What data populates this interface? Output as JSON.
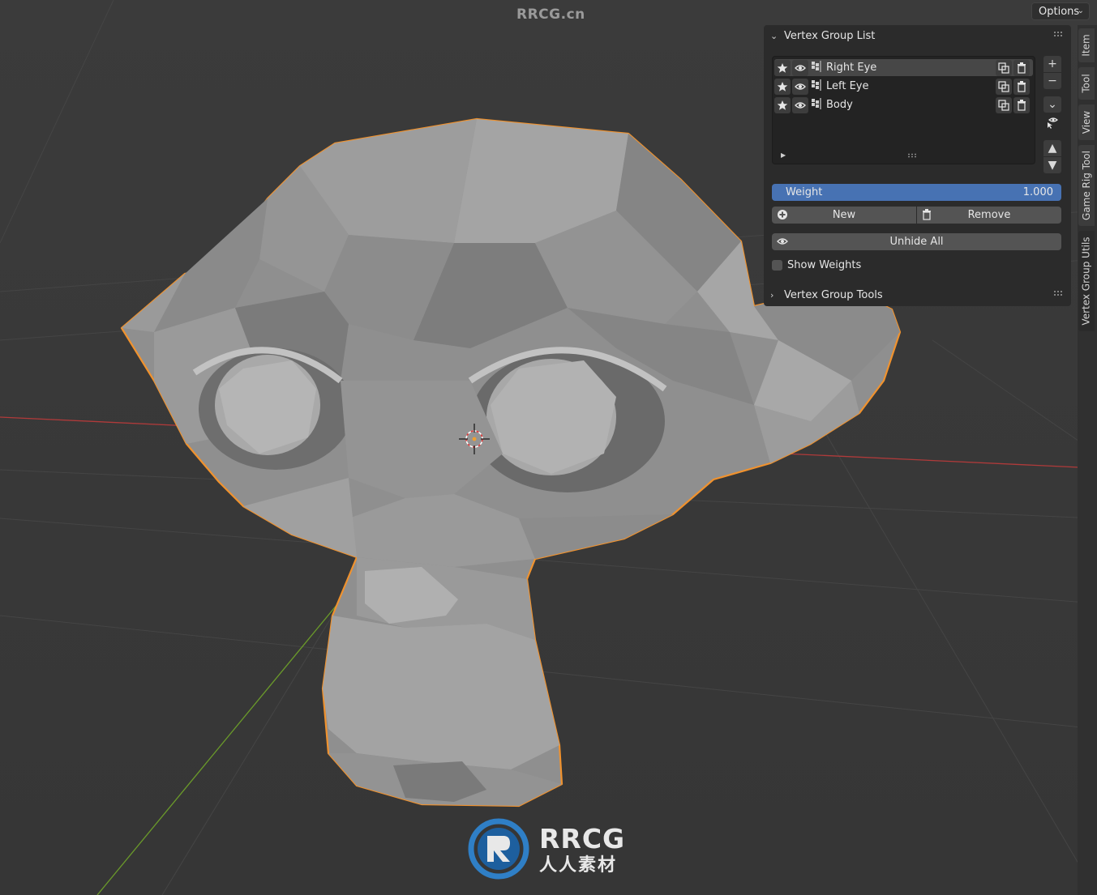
{
  "watermark_top": "RRCG.cn",
  "header": {
    "options_label": "Options"
  },
  "panel": {
    "section1_title": "Vertex Group List",
    "groups": [
      {
        "name": "Right Eye",
        "active": true
      },
      {
        "name": "Left Eye",
        "active": false
      },
      {
        "name": "Body",
        "active": false
      }
    ],
    "weight_label": "Weight",
    "weight_value": "1.000",
    "new_label": "New",
    "remove_label": "Remove",
    "unhide_label": "Unhide All",
    "show_weights_label": "Show Weights",
    "show_weights_checked": false,
    "section2_title": "Vertex Group Tools"
  },
  "tabs": [
    "Item",
    "Tool",
    "View",
    "Game Rig Tool",
    "Vertex Group Utils"
  ],
  "active_tab": "Vertex Group Utils",
  "logo": {
    "title": "RRCG",
    "subtitle": "人人素材"
  },
  "colors": {
    "selection_outline": "#f0922e",
    "accent": "#4772b3",
    "x_axis": "#b03a3a",
    "y_axis": "#6a9a2a"
  },
  "icons": [
    "star-icon",
    "eye-icon",
    "vertex-group-icon",
    "copy-icon",
    "trash-icon",
    "plus-icon",
    "minus-icon",
    "chevron-down-icon",
    "arrow-up-icon",
    "arrow-down-icon",
    "add-circle-icon"
  ]
}
